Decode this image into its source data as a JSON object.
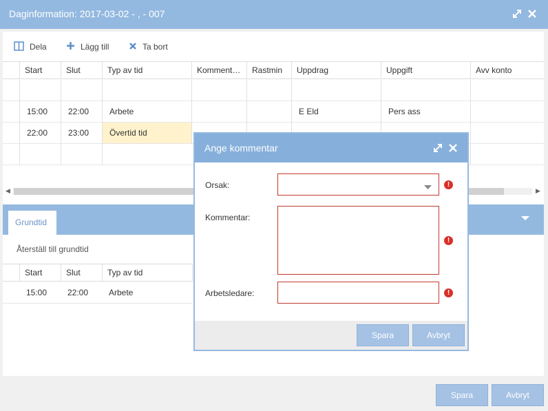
{
  "window": {
    "title": "Daginformation: 2017-03-02 - , - 007"
  },
  "toolbar": {
    "split_label": "Dela",
    "add_label": "Lägg till",
    "remove_label": "Ta bort"
  },
  "grid": {
    "columns": [
      "Start",
      "Slut",
      "Typ av tid",
      "Komment…",
      "Rastmin",
      "Uppdrag",
      "Uppgift",
      "Avv konto"
    ],
    "rows": [
      {
        "start": "",
        "slut": "",
        "typ": "",
        "komment": "",
        "rastmin": "",
        "uppdrag": "",
        "uppgift": "",
        "avv": ""
      },
      {
        "start": "15:00",
        "slut": "22:00",
        "typ": "Arbete",
        "komment": "",
        "rastmin": "",
        "uppdrag": "E Eld",
        "uppgift": "Pers ass",
        "avv": ""
      },
      {
        "start": "22:00",
        "slut": "23:00",
        "typ": "Övertid tid",
        "komment": "",
        "rastmin": "",
        "uppdrag": "",
        "uppgift": "",
        "avv": ""
      }
    ],
    "highlight_color": "#fff2cc"
  },
  "lower": {
    "tab_label": "Grundtid",
    "reset_link": "Återställ till grundtid",
    "columns": [
      "Start",
      "Slut",
      "Typ av tid"
    ],
    "row": {
      "start": "15:00",
      "slut": "22:00",
      "typ": "Arbete"
    }
  },
  "dialog": {
    "title": "Ange kommentar",
    "fields": {
      "orsak_label": "Orsak:",
      "orsak_value": "",
      "kommentar_label": "Kommentar:",
      "kommentar_value": "",
      "arbetsledare_label": "Arbetsledare:",
      "arbetsledare_value": ""
    },
    "save_label": "Spara",
    "cancel_label": "Avbryt"
  },
  "footer": {
    "save_label": "Spara",
    "cancel_label": "Avbryt"
  },
  "colors": {
    "accent": "#94b9e0",
    "error": "#d9302a",
    "button": "#a5c2e4"
  }
}
